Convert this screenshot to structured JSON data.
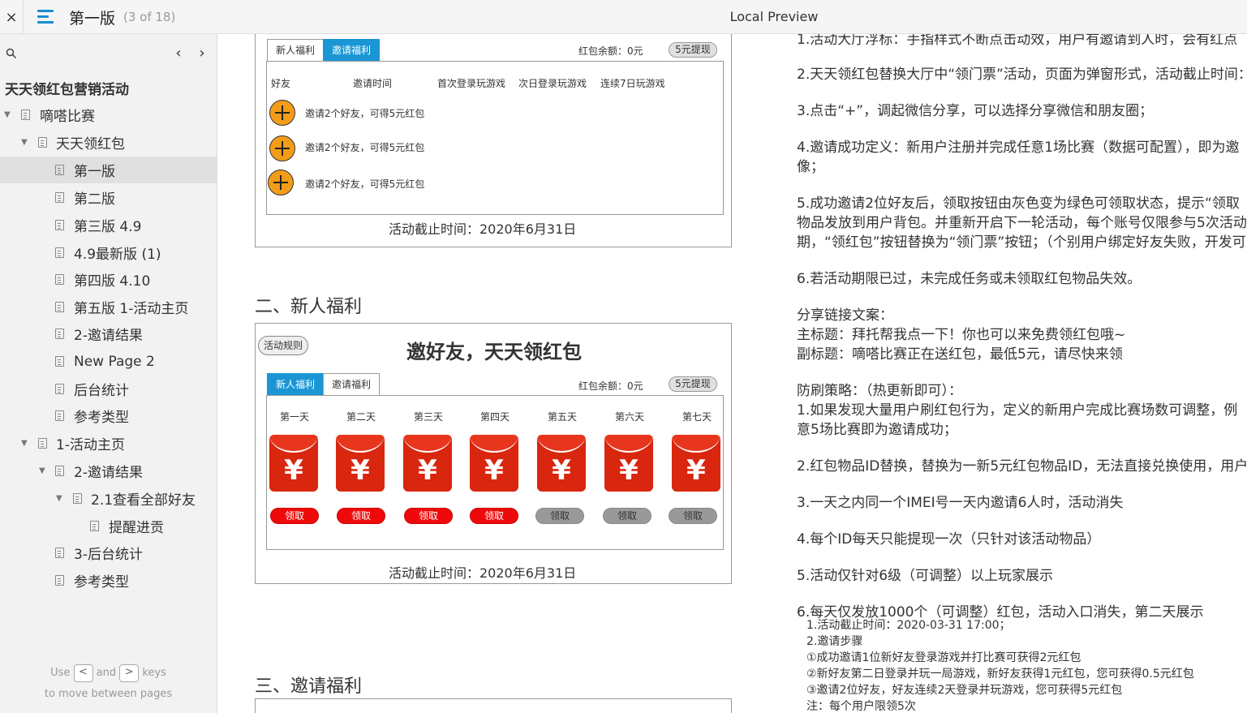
{
  "topbar": {
    "close": "×",
    "page_title": "第一版",
    "page_count": "(3 of 18)",
    "app_title": "Local Preview"
  },
  "sidebar": {
    "prev": "‹",
    "next": "›",
    "project_title": "天天领红包营销活动",
    "items": [
      {
        "label": "嘀嗒比赛"
      },
      {
        "label": "天天领红包"
      },
      {
        "label": "第一版"
      },
      {
        "label": "第二版"
      },
      {
        "label": "第三版 4.9"
      },
      {
        "label": "4.9最新版 (1)"
      },
      {
        "label": "第四版 4.10"
      },
      {
        "label": "第五版 1-活动主页"
      },
      {
        "label": "2-邀请结果"
      },
      {
        "label": "New Page 2"
      },
      {
        "label": "后台统计"
      },
      {
        "label": "参考类型"
      },
      {
        "label": "1-活动主页"
      },
      {
        "label": "2-邀请结果"
      },
      {
        "label": "2.1查看全部好友"
      },
      {
        "label": "提醒进贡"
      },
      {
        "label": "3-后台统计"
      },
      {
        "label": "参考类型"
      }
    ],
    "hint": {
      "use": "Use",
      "key_prev": "<",
      "and": "and",
      "key_next": ">",
      "keys": "keys",
      "line2": "to move between pages"
    }
  },
  "section1": {
    "tab_new": "新人福利",
    "tab_invite": "邀请福利",
    "balance": "红包余额：0元",
    "withdraw": "5元提现",
    "columns": [
      "好友",
      "邀请时间",
      "首次登录玩游戏",
      "次日登录玩游戏",
      "连续7日玩游戏"
    ],
    "rows": [
      "邀请2个好友，可得5元红包",
      "邀请2个好友，可得5元红包",
      "邀请2个好友，可得5元红包"
    ],
    "deadline": "活动截止时间：2020年6月31日"
  },
  "section2": {
    "heading": "二、新人福利",
    "rules": "活动规则",
    "title": "邀好友，天天领红包",
    "tab_new": "新人福利",
    "tab_invite": "邀请福利",
    "balance": "红包余额：0元",
    "withdraw": "5元提现",
    "yen": "¥",
    "days": [
      {
        "label": "第一天",
        "claim": "领取",
        "state": "active"
      },
      {
        "label": "第二天",
        "claim": "领取",
        "state": "active"
      },
      {
        "label": "第三天",
        "claim": "领取",
        "state": "active"
      },
      {
        "label": "第四天",
        "claim": "领取",
        "state": "active"
      },
      {
        "label": "第五天",
        "claim": "领取",
        "state": "disabled"
      },
      {
        "label": "第六天",
        "claim": "领取",
        "state": "disabled"
      },
      {
        "label": "第七天",
        "claim": "领取",
        "state": "disabled"
      }
    ],
    "deadline": "活动截止时间：2020年6月31日"
  },
  "section3": {
    "heading": "三、邀请福利"
  },
  "notes": {
    "lines": [
      "1.活动大厅浮标：手指样式不断点击动效，用户有邀请到人时，会有红点",
      "2.天天领红包替换大厅中“领门票”活动，页面为弹窗形式，活动截止时间：",
      "3.点击“+”，调起微信分享，可以选择分享微信和朋友圈；",
      "4.邀请成功定义：新用户注册并完成任意1场比赛（数据可配置），即为邀",
      "像；",
      "5.成功邀请2位好友后，领取按钮由灰色变为绿色可领取状态，提示“领取",
      "物品发放到用户背包。并重新开启下一轮活动，每个账号仅限参与5次活动",
      "期，“领红包”按钮替换为“领门票”按钮；（个别用户绑定好友失败，开发可",
      "6.若活动期限已过，未完成任务或未领取红包物品失效。",
      "分享链接文案：",
      "主标题：拜托帮我点一下！你也可以来免费领红包哦~",
      "副标题：嘀嗒比赛正在送红包，最低5元，请尽快来领",
      "防刷策略：（热更新即可）：",
      "1.如果发现大量用户刷红包行为，定义的新用户完成比赛场数可调整，例",
      "意5场比赛即为邀请成功；",
      "2.红包物品ID替换，替换为一新5元红包物品ID，无法直接兑换使用，用户",
      "3.一天之内同一个IMEI号一天内邀请6人时，活动消失",
      "4.每个ID每天只能提现一次（只针对该活动物品）",
      "5.活动仅针对6级（可调整）以上玩家展示",
      "6.每天仅发放1000个（可调整）红包，活动入口消失，第二天展示"
    ],
    "small": [
      "1.活动截止时间：2020-03-31 17:00；",
      "2.邀请步骤",
      "①成功邀请1位新好友登录游戏并打比赛可获得2元红包",
      "②新好友第二日登录并玩一局游戏，新好友获得1元红包，您可获得0.5元红包",
      "③邀请2位好友，好友连续2天登录并玩游戏，您可获得5元红包",
      "注：每个用户限领5次"
    ]
  }
}
